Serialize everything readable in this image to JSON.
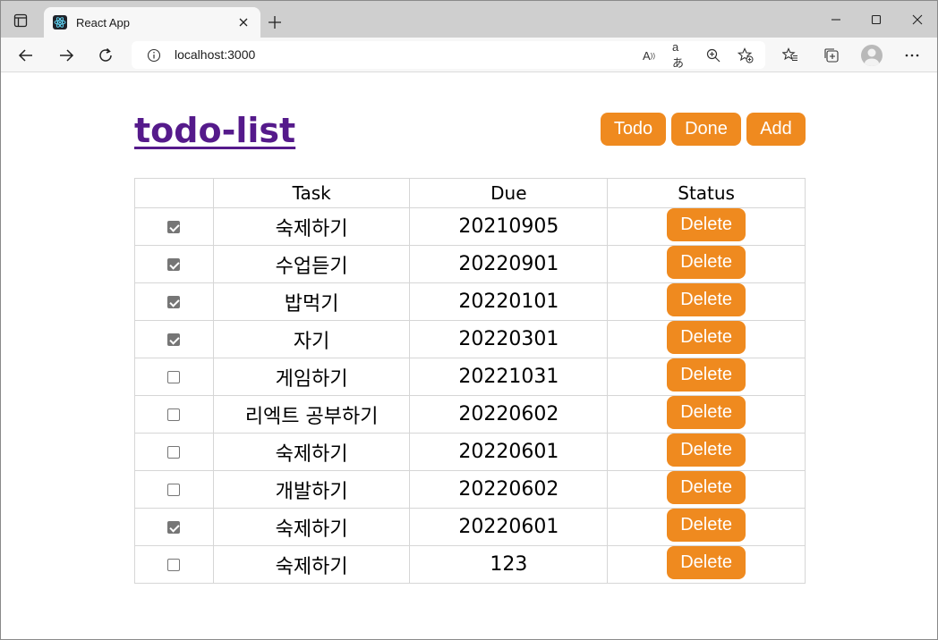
{
  "browser": {
    "tab_title": "React App",
    "url": "localhost:3000"
  },
  "header": {
    "title": "todo-list",
    "buttons": {
      "todo": "Todo",
      "done": "Done",
      "add": "Add"
    }
  },
  "table": {
    "columns": [
      "",
      "Task",
      "Due",
      "Status"
    ],
    "delete_label": "Delete",
    "rows": [
      {
        "checked": true,
        "task": "숙제하기",
        "due": "20210905"
      },
      {
        "checked": true,
        "task": "수업듣기",
        "due": "20220901"
      },
      {
        "checked": true,
        "task": "밥먹기",
        "due": "20220101"
      },
      {
        "checked": true,
        "task": "자기",
        "due": "20220301"
      },
      {
        "checked": false,
        "task": "게임하기",
        "due": "20221031"
      },
      {
        "checked": false,
        "task": "리엑트 공부하기",
        "due": "20220602"
      },
      {
        "checked": false,
        "task": "숙제하기",
        "due": "20220601"
      },
      {
        "checked": false,
        "task": "개발하기",
        "due": "20220602"
      },
      {
        "checked": true,
        "task": "숙제하기",
        "due": "20220601"
      },
      {
        "checked": false,
        "task": "숙제하기",
        "due": "123"
      }
    ]
  },
  "colors": {
    "accent": "#ef8a1f",
    "link": "#551a8b"
  }
}
